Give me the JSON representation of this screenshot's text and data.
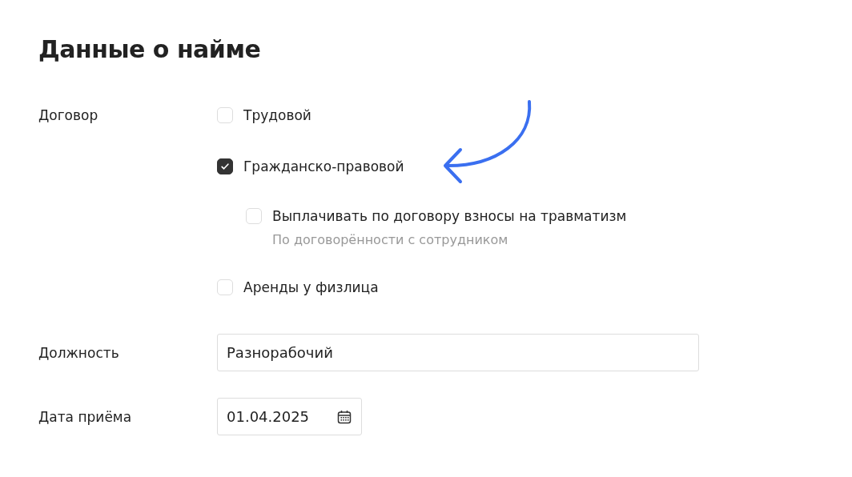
{
  "title": "Данные о найме",
  "contract": {
    "label": "Договор",
    "options": [
      {
        "label": "Трудовой",
        "checked": false
      },
      {
        "label": "Гражданско-правовой",
        "checked": true,
        "children": [
          {
            "label": "Выплачивать по договору взносы на травматизм",
            "hint": "По договорённости с сотрудником",
            "checked": false
          }
        ]
      },
      {
        "label": "Аренды у физлица",
        "checked": false
      }
    ]
  },
  "fields": [
    {
      "kind": "text",
      "label": "Должность",
      "value": "Разнорабочий"
    },
    {
      "kind": "date",
      "label": "Дата приёма",
      "value": "01.04.2025"
    }
  ]
}
